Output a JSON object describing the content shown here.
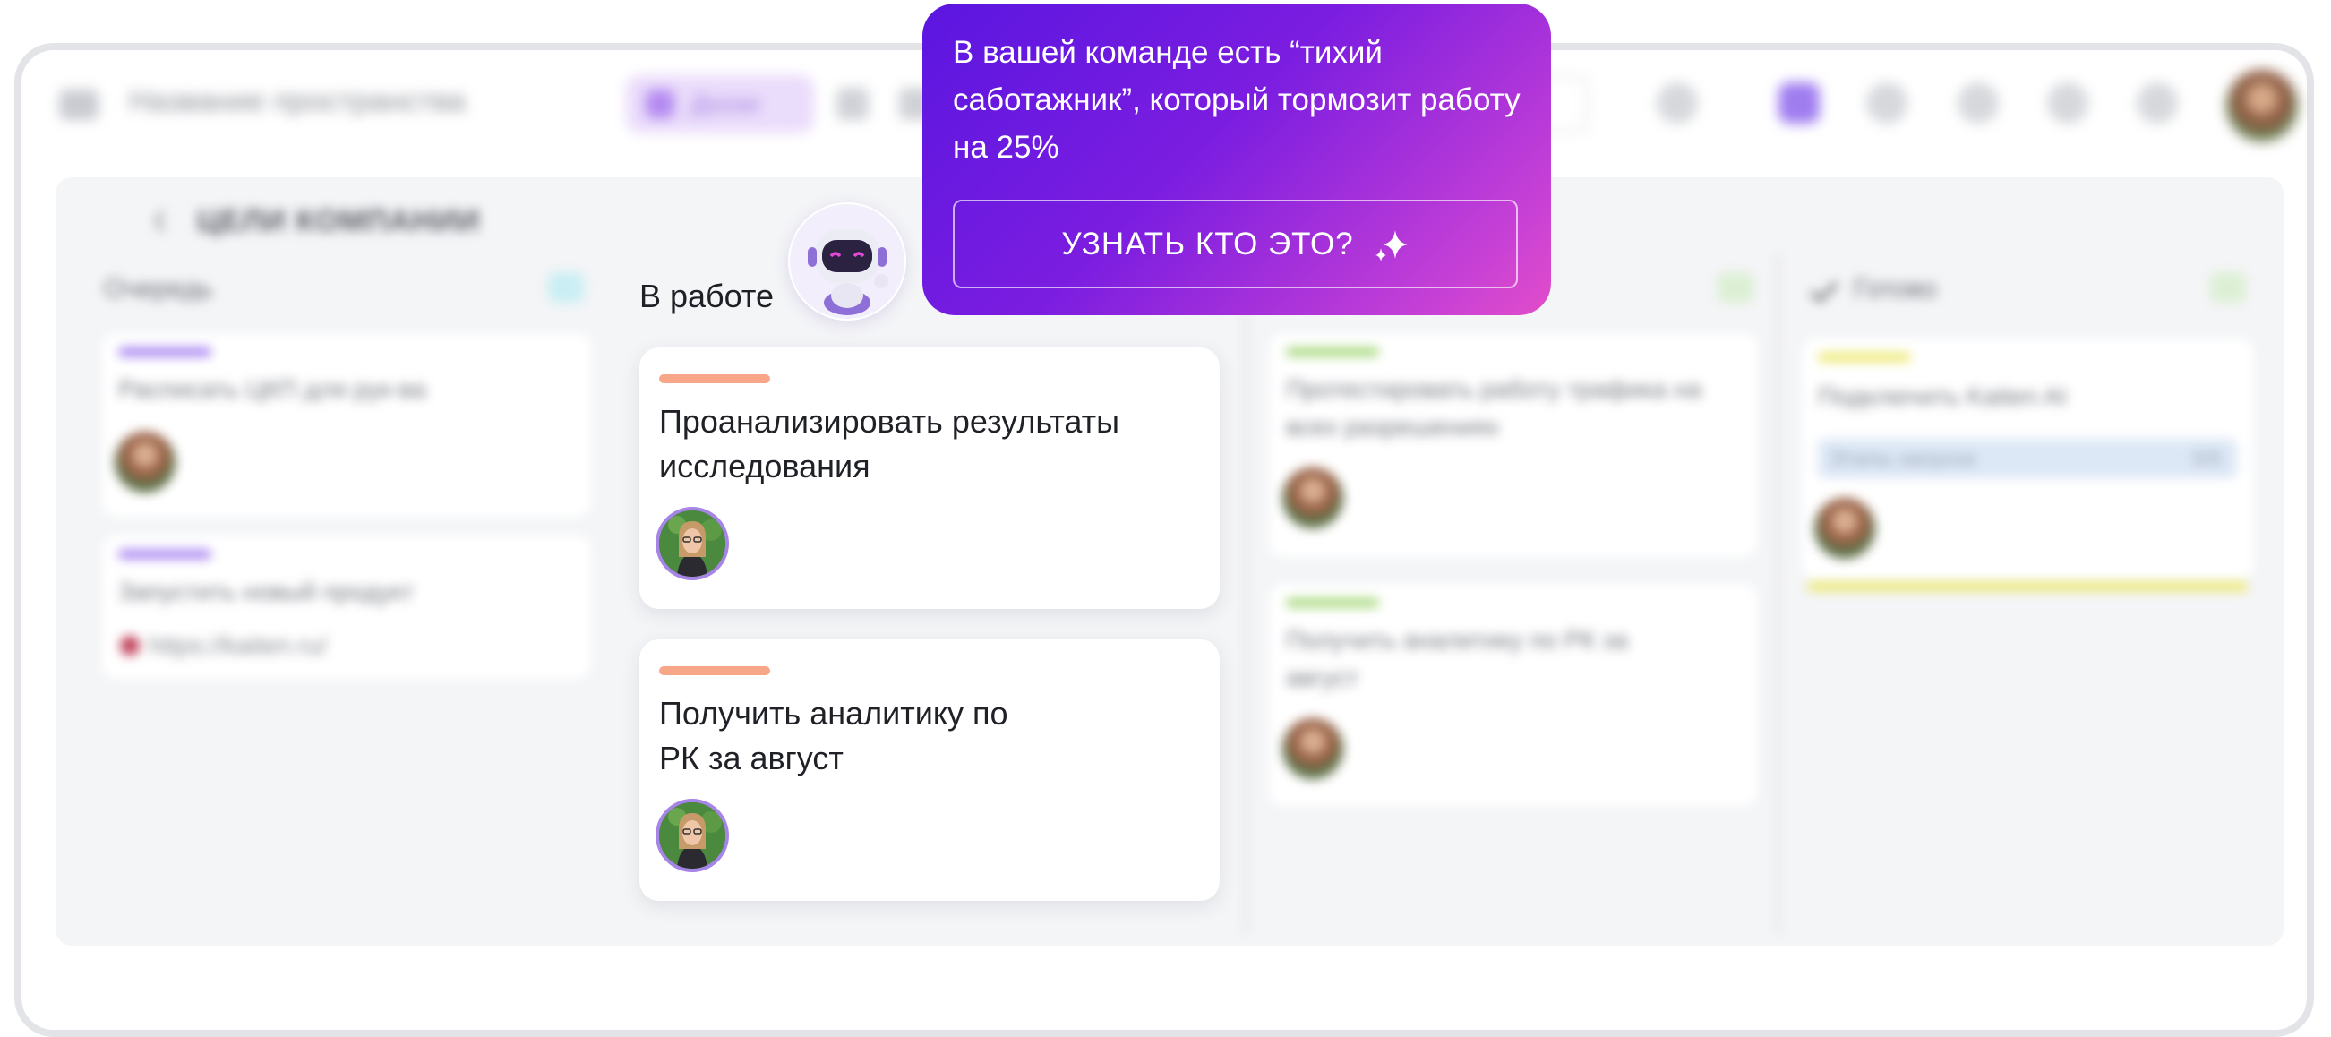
{
  "topbar": {
    "workspace_title": "Название пространства",
    "active_tab_label": "Доски"
  },
  "board": {
    "title": "ЦЕЛИ КОМПАНИИ",
    "columns": [
      {
        "name": "Очередь",
        "cards": [
          {
            "title": "Расписать ЦКП для рук-ва"
          },
          {
            "title": "Запустить новый продукт",
            "link": "https://kaiten.ru/"
          }
        ]
      },
      {
        "name": "В работе",
        "cards": [
          {
            "title": "Проанализировать результаты исследования"
          },
          {
            "title": "Получить аналитику по РК за август"
          }
        ]
      },
      {
        "name": "",
        "cards": [
          {
            "title_line1": "Протестировать работу трафика на",
            "title_line2": "всех разрешениях"
          },
          {
            "title_line1": "Получить аналитику по РК за",
            "title_line2": "август"
          }
        ]
      },
      {
        "name": "Готово",
        "cards": [
          {
            "title": "Подключить Kaiten AI",
            "progress_label": "Этапы запуска",
            "progress_value": "5/5"
          }
        ]
      }
    ]
  },
  "popup": {
    "message": "В вашей команде есть “тихий саботажник”, который тормозит работу на 25%",
    "button_label": "УЗНАТЬ КТО ЭТО?"
  },
  "colors": {
    "popup_gradient_start": "#5b16e0",
    "popup_gradient_end": "#e24dca",
    "card_stripe_orange": "#f7a688",
    "stripe_violet": "#a57ff0",
    "stripe_green": "#a5d67a",
    "stripe_yellow": "#ece86c",
    "avatar_ring": "#a685e6"
  },
  "icons": [
    "menu-icon",
    "board-icon",
    "search-icon",
    "bell-icon",
    "help-icon",
    "settings-icon",
    "robot-mascot-icon",
    "sparkle-icon",
    "check-icon",
    "back-arrow-icon"
  ]
}
